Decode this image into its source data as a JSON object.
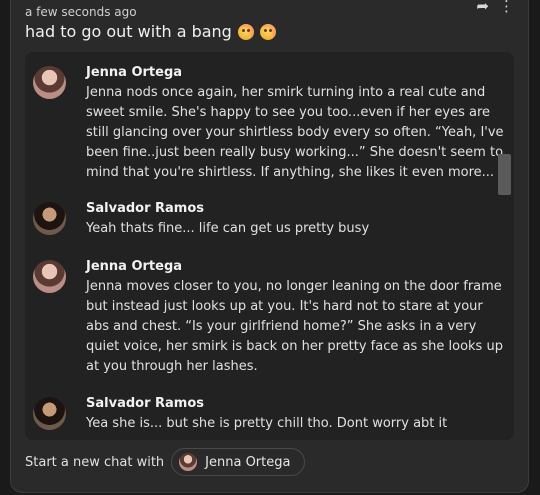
{
  "post": {
    "timestamp": "a few seconds ago",
    "title": "had to go out with a bang",
    "emojis": [
      "flushed-face",
      "flushed-face"
    ]
  },
  "icons": {
    "share": "share-arrow-icon",
    "more": "more-vertical-icon"
  },
  "messages": [
    {
      "author": "Jenna Ortega",
      "avatar": "jenna-avatar",
      "text": "Jenna nods once again, her smirk turning into a real cute and sweet smile. She's happy to see you too...even if her eyes are still glancing over your shirtless body every so often. “Yeah, I've been fine..just been really busy working...” She doesn't seem to mind that you're shirtless. If anything, she likes it even more..."
    },
    {
      "author": "Salvador Ramos",
      "avatar": "salvador-avatar",
      "text": "Yeah thats fine... life can get us pretty busy"
    },
    {
      "author": "Jenna Ortega",
      "avatar": "jenna-avatar",
      "text": "Jenna moves closer to you, no longer leaning on the door frame but instead just looks up at you. It's hard not to stare at your abs and chest. “Is your girlfriend home?” She asks in a very quiet voice, her smirk is back on her pretty face as she looks up at you through her lashes."
    },
    {
      "author": "Salvador Ramos",
      "avatar": "salvador-avatar",
      "text": "Yea she is... but she is pretty chill tho. Dont worry abt it"
    }
  ],
  "footer": {
    "label": "Start a new chat with",
    "chip_label": "Jenna Ortega"
  }
}
